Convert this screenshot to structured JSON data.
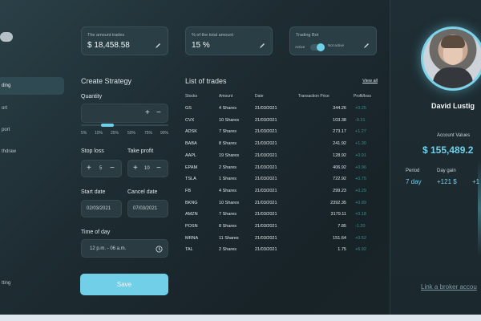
{
  "sidebar": {
    "items": [
      {
        "label": "ding",
        "active": true
      },
      {
        "label": "ort"
      },
      {
        "label": "port"
      },
      {
        "label": "thdraw"
      },
      {
        "label": "tting"
      }
    ]
  },
  "stats": {
    "amount_trades": {
      "label": "The amount trades",
      "value": "$ 18,458.58"
    },
    "percent_total": {
      "label": "% of the total amount",
      "value": "15 %"
    },
    "trading_bot": {
      "label": "Trading Bot",
      "left_option": "Active",
      "right_option": "Not active"
    }
  },
  "strategy": {
    "title": "Create Strategy",
    "quantity_label": "Quantity",
    "plus": "+",
    "minus": "−",
    "percentages": [
      "5%",
      "10%",
      "25%",
      "50%",
      "75%",
      "90%"
    ],
    "slider_fraction": 0.25,
    "stop_loss_label": "Stop loss",
    "stop_loss_value": "5",
    "take_profit_label": "Take profit",
    "take_profit_value": "10",
    "start_date_label": "Start date",
    "start_date_value": "02/03/2021",
    "cancel_date_label": "Cancel date",
    "cancel_date_value": "07/03/2021",
    "time_label": "Time of day",
    "time_value": "12 p.m. - 06 a.m.",
    "save_label": "Save"
  },
  "trades": {
    "title": "List of trades",
    "view_all": "View all",
    "columns": [
      "Stocks",
      "Amount",
      "Date",
      "Transaction Price",
      "Profit/loss"
    ],
    "rows": [
      [
        "GS",
        "4 Shares",
        "21/03/2021",
        "344.26",
        "+0.25"
      ],
      [
        "CVX",
        "10 Shares",
        "21/03/2021",
        "103.38",
        "-0.31"
      ],
      [
        "ADSK",
        "7 Shares",
        "21/03/2021",
        "273.17",
        "+1.27"
      ],
      [
        "BABA",
        "8 Shares",
        "21/03/2021",
        "241.92",
        "+1.30"
      ],
      [
        "AAPL",
        "19 Shares",
        "21/03/2021",
        "128.92",
        "+0.91"
      ],
      [
        "EPAM",
        "2 Shares",
        "21/03/2021",
        "406.92",
        "+0.96"
      ],
      [
        "TSLA",
        "1 Shares",
        "21/03/2021",
        "722.92",
        "+0.75"
      ],
      [
        "FB",
        "4 Shares",
        "21/03/2021",
        "299.23",
        "+0.29"
      ],
      [
        "BKNG",
        "10 Shares",
        "21/03/2021",
        "2392.35",
        "+0.89"
      ],
      [
        "AMZN",
        "7 Shares",
        "21/03/2021",
        "3179.11",
        "+0.18"
      ],
      [
        "POSN",
        "8 Shares",
        "21/03/2021",
        "7.85",
        "-1.20"
      ],
      [
        "MRNA",
        "11 Shares",
        "21/03/2021",
        "151.64",
        "+0.52"
      ],
      [
        "TAL",
        "2 Shares",
        "21/03/2021",
        "1.75",
        "+6.92"
      ]
    ]
  },
  "profile": {
    "name": "David Lustig",
    "account_label": "Account Values",
    "account_value": "$ 155,489.2",
    "period_label": "Period",
    "period_value": "7 day",
    "day_gain_label": "Day gain",
    "day_gain_value": "+121 $",
    "extra_value": "+1",
    "link_label": "Link a broker accou"
  },
  "colors": {
    "accent": "#6fd0ea",
    "profit": "#3f8d8a"
  }
}
